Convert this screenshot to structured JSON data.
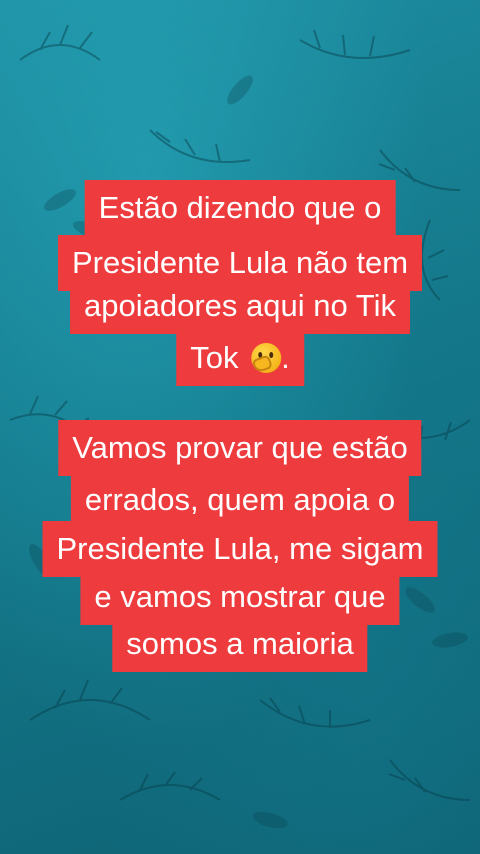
{
  "caption_1": {
    "lines": [
      "Estão dizendo que o",
      "Presidente Lula não tem",
      "apoiadores aqui no Tik",
      "Tok"
    ],
    "trailing": ".",
    "emoji": "thinking-face-icon"
  },
  "caption_2": {
    "lines": [
      "Vamos provar que estão",
      "errados, quem apoia o",
      "Presidente Lula, me sigam",
      "e vamos mostrar que",
      "somos a maioria"
    ]
  },
  "colors": {
    "caption_bg": "#ee3b3d",
    "caption_text": "#ffffff",
    "background": "#1a8296"
  }
}
